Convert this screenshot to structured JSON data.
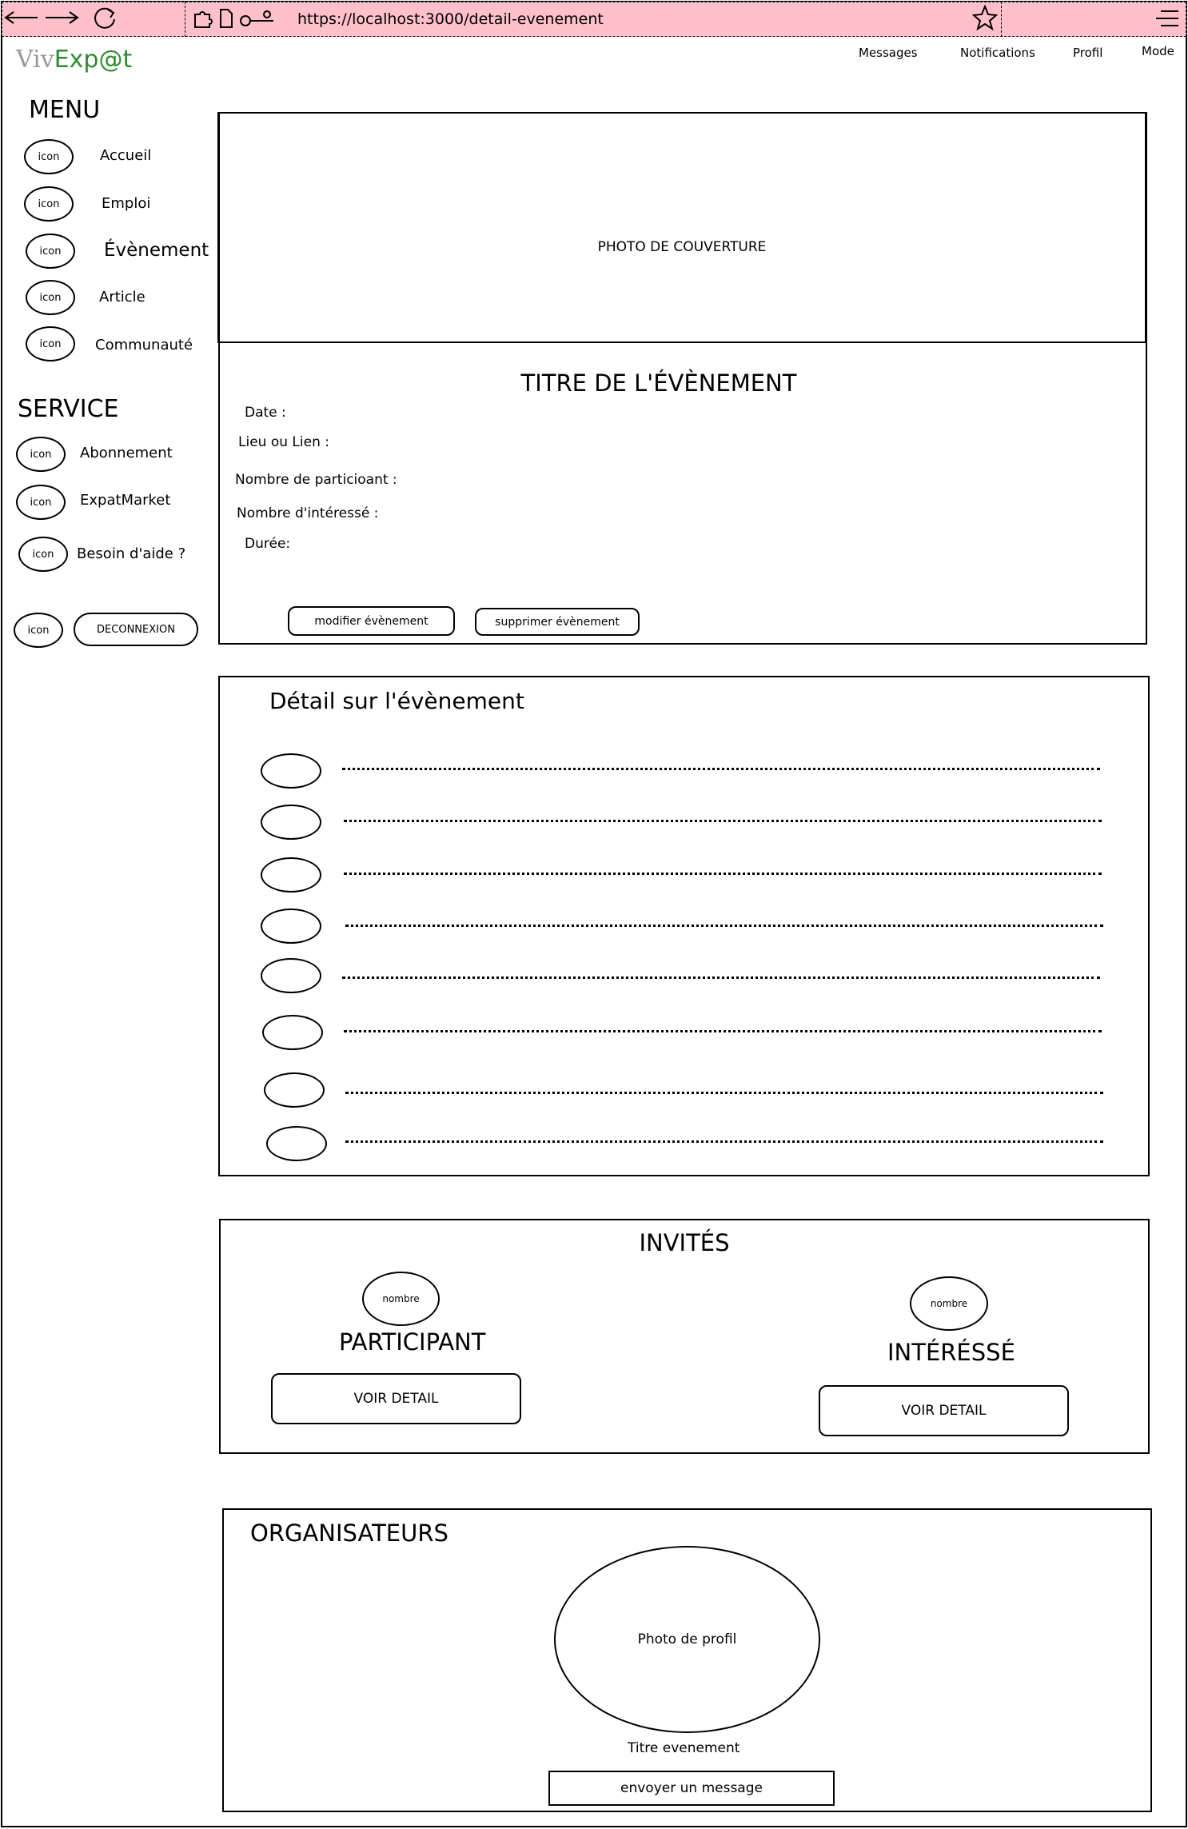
{
  "browser": {
    "url": "https://localhost:3000/detail-evenement",
    "icons": [
      "back-arrow-icon",
      "forward-arrow-icon",
      "reload-icon",
      "extension-icon",
      "page-icon",
      "key-icon",
      "star-icon",
      "hamburger-menu-icon"
    ]
  },
  "header": {
    "logo_part1": "Viv",
    "logo_part2": "Exp@t",
    "logo_colors": {
      "part1": "#999999",
      "part2": "#2e8b2e"
    },
    "nav": [
      "Messages",
      "Notifications",
      "Profil",
      "Mode"
    ]
  },
  "sidebar": {
    "menu_title": "MENU",
    "menu_items": [
      {
        "icon": "icon",
        "label": "Accueil"
      },
      {
        "icon": "icon",
        "label": "Emploi"
      },
      {
        "icon": "icon",
        "label": "Évènement"
      },
      {
        "icon": "icon",
        "label": "Article"
      },
      {
        "icon": "icon",
        "label": "Communauté"
      }
    ],
    "service_title": "SERVICE",
    "service_items": [
      {
        "icon": "icon",
        "label": "Abonnement"
      },
      {
        "icon": "icon",
        "label": "ExpatMarket"
      },
      {
        "icon": "icon",
        "label": "Besoin d'aide ?"
      }
    ],
    "logout_icon": "icon",
    "logout_label": "DECONNEXION"
  },
  "event": {
    "cover": "PHOTO DE COUVERTURE",
    "title": "TITRE DE L'ÉVÈNEMENT",
    "fields": [
      "Date :",
      "Lieu ou Lien :",
      "Nombre de particioant :",
      "Nombre d'intéressé :",
      "Durée:"
    ],
    "edit_button": "modifier évènement",
    "delete_button": "supprimer évènement"
  },
  "details": {
    "title": "Détail sur l'évènement",
    "row_count_label": ""
  },
  "guests": {
    "title": "INVITÉS",
    "participant_count": "nombre",
    "participant_label": "PARTICIPANT",
    "participant_button": "VOIR DETAIL",
    "interested_count": "nombre",
    "interested_label": "INTÉRÉSSÉ",
    "interested_button": "VOIR DETAIL"
  },
  "organizers": {
    "title": "ORGANISATEURS",
    "photo": "Photo de profil",
    "event_title": "Titre evenement",
    "message_button": "envoyer un message"
  },
  "accent_color": "#ffc0cb"
}
